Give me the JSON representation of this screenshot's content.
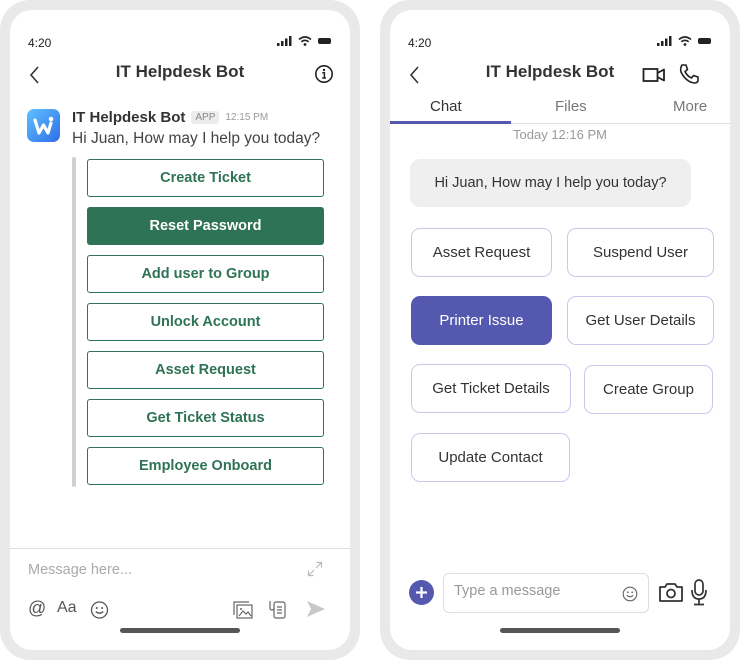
{
  "left_phone": {
    "status": {
      "time": "4:20"
    },
    "header": {
      "title": "IT Helpdesk Bot"
    },
    "message": {
      "sender": "IT Helpdesk Bot",
      "badge": "APP",
      "time": "12:15 PM",
      "text": "Hi Juan, How may I help you today?"
    },
    "card_buttons": [
      {
        "label": "Create Ticket",
        "active": false
      },
      {
        "label": "Reset Password",
        "active": true
      },
      {
        "label": "Add user to Group",
        "active": false
      },
      {
        "label": "Unlock Account",
        "active": false
      },
      {
        "label": "Asset Request",
        "active": false
      },
      {
        "label": "Get Ticket Status",
        "active": false
      },
      {
        "label": "Employee Onboard",
        "active": false
      }
    ],
    "composer": {
      "placeholder": "Message here...",
      "format_label": "Aa"
    },
    "accent_color": "#2e7355"
  },
  "right_phone": {
    "status": {
      "time": "4:20"
    },
    "header": {
      "title": "IT Helpdesk Bot"
    },
    "tabs": [
      {
        "label": "Chat",
        "active": true
      },
      {
        "label": "Files",
        "active": false
      },
      {
        "label": "More",
        "active": false
      }
    ],
    "timestamp": "Today 12:16 PM",
    "bubble_text": "Hi Juan, How may I help you today?",
    "chips": [
      {
        "label": "Asset Request",
        "active": false
      },
      {
        "label": "Suspend User",
        "active": false
      },
      {
        "label": "Printer Issue",
        "active": true
      },
      {
        "label": "Get User Details",
        "active": false
      },
      {
        "label": "Get Ticket Details",
        "active": false
      },
      {
        "label": "Create Group",
        "active": false
      },
      {
        "label": "Update Contact",
        "active": false
      }
    ],
    "composer": {
      "placeholder": "Type a message"
    },
    "accent_color": "#5558af"
  }
}
